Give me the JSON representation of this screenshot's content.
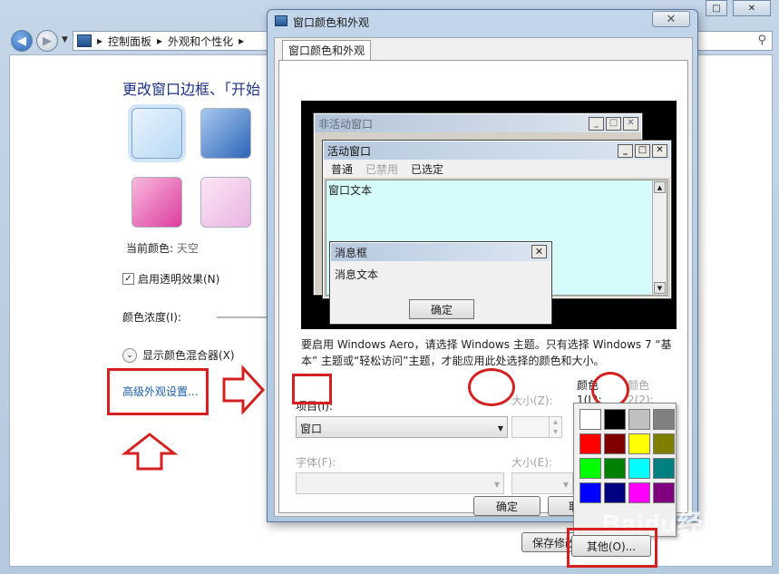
{
  "explorer": {
    "breadcrumb_1": "控制面板",
    "breadcrumb_2": "外观和个性化",
    "heading": "更改窗口边框、「开始",
    "current_color_label": "当前颜色:",
    "current_color_value": "天空",
    "transparency_label": "启用透明效果(N)",
    "transparency_checked": "✓",
    "intensity_label": "颜色浓度(I):",
    "mixer_label": "显示颜色混合器(X)",
    "advanced_link": "高级外观设置...",
    "save_button": "保存修改"
  },
  "dialog": {
    "title": "窗口颜色和外观",
    "tab": "窗口颜色和外观",
    "preview": {
      "inactive_title": "非活动窗口",
      "active_title": "活动窗口",
      "menu_normal": "普通",
      "menu_disabled": "已禁用",
      "menu_selected": "已选定",
      "window_text": "窗口文本",
      "msgbox_title": "消息框",
      "msgbox_text": "消息文本",
      "msgbox_ok": "确定"
    },
    "description": "要启用 Windows Aero，请选择 Windows 主题。只有选择 Windows 7 “基本” 主题或“轻松访问”主题，才能应用此处选择的颜色和大小。",
    "item_label": "项目(I):",
    "item_value": "窗口",
    "size_label": "大小(Z):",
    "color1_label_a": "颜色",
    "color1_label_b": "1(L):",
    "color2_label_a": "颜色",
    "color2_label_b": "2(2):",
    "font_label": "字体(F):",
    "font_size_label": "大小(E):",
    "ok_button": "确定",
    "cancel_button_partial": "取"
  },
  "palette": {
    "colors": [
      "#ffffff",
      "#000000",
      "#c0c0c0",
      "#808080",
      "#ff0000",
      "#800000",
      "#ffff00",
      "#808000",
      "#00ff00",
      "#008000",
      "#00ffff",
      "#008080",
      "#0000ff",
      "#000080",
      "#ff00ff",
      "#800080"
    ],
    "other_button": "其他(O)..."
  },
  "watermark": "Baidu经验",
  "accent_colors": {
    "annotation_red": "#d42020",
    "window_text_bg": "#d5fbfb"
  }
}
